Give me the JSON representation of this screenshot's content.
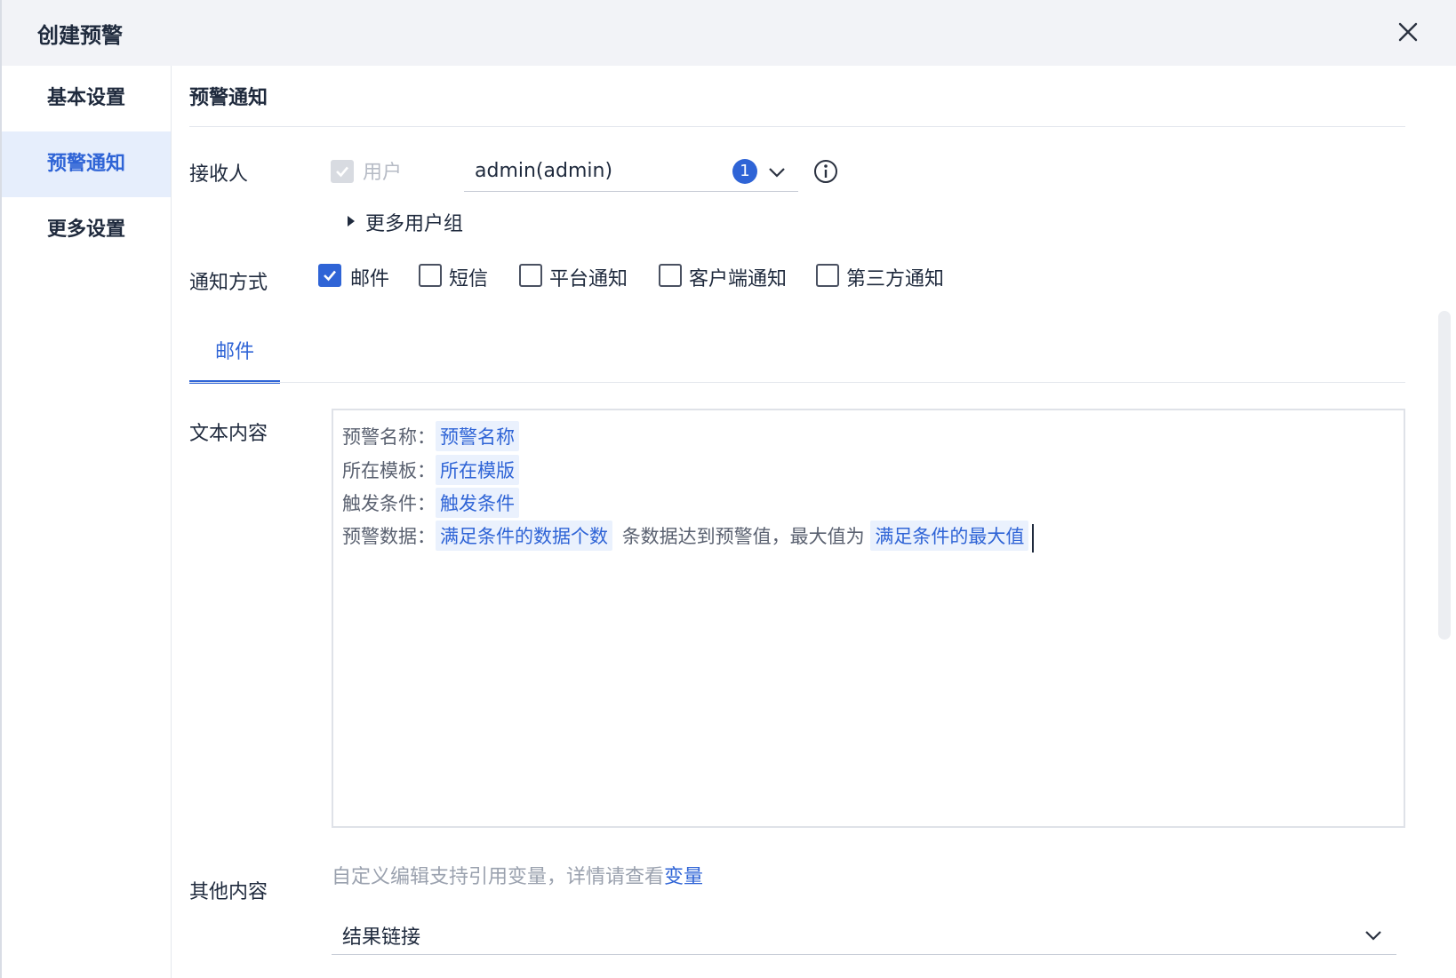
{
  "dialog": {
    "title": "创建预警",
    "close_icon": "close-icon"
  },
  "sidebar": {
    "items": [
      {
        "label": "基本设置",
        "active": false
      },
      {
        "label": "预警通知",
        "active": true
      },
      {
        "label": "更多设置",
        "active": false
      }
    ]
  },
  "section": {
    "title": "预警通知"
  },
  "recipient": {
    "label": "接收人",
    "user_checkbox_label": "用户",
    "user_checked": true,
    "user_disabled": true,
    "select_value": "admin(admin)",
    "select_count": "1",
    "info_icon": "info-icon",
    "more_groups_label": "更多用户组"
  },
  "notify": {
    "label": "通知方式",
    "options": [
      {
        "label": "邮件",
        "checked": true
      },
      {
        "label": "短信",
        "checked": false
      },
      {
        "label": "平台通知",
        "checked": false
      },
      {
        "label": "客户端通知",
        "checked": false
      },
      {
        "label": "第三方通知",
        "checked": false
      }
    ]
  },
  "tabs": [
    {
      "label": "邮件",
      "active": true
    }
  ],
  "text_content": {
    "label": "文本内容",
    "lines": [
      {
        "prefix": "预警名称：",
        "chip": "预警名称"
      },
      {
        "prefix": "所在模板：",
        "chip": "所在模版"
      },
      {
        "prefix": "触发条件：",
        "chip": "触发条件"
      },
      {
        "prefix": "预警数据：",
        "chip": "满足条件的数据个数",
        "middle": "条数据达到预警值，最大值为",
        "chip2": "满足条件的最大值"
      }
    ],
    "hint_text": "自定义编辑支持引用变量，详情请查看",
    "hint_link": "变量"
  },
  "other_content": {
    "label": "其他内容",
    "select_value": "结果链接"
  },
  "colors": {
    "accent": "#2f64d6",
    "header_bg": "#f2f3f7",
    "sidebar_active_bg": "#e6eefc",
    "chip_bg": "#eaf1fd"
  }
}
